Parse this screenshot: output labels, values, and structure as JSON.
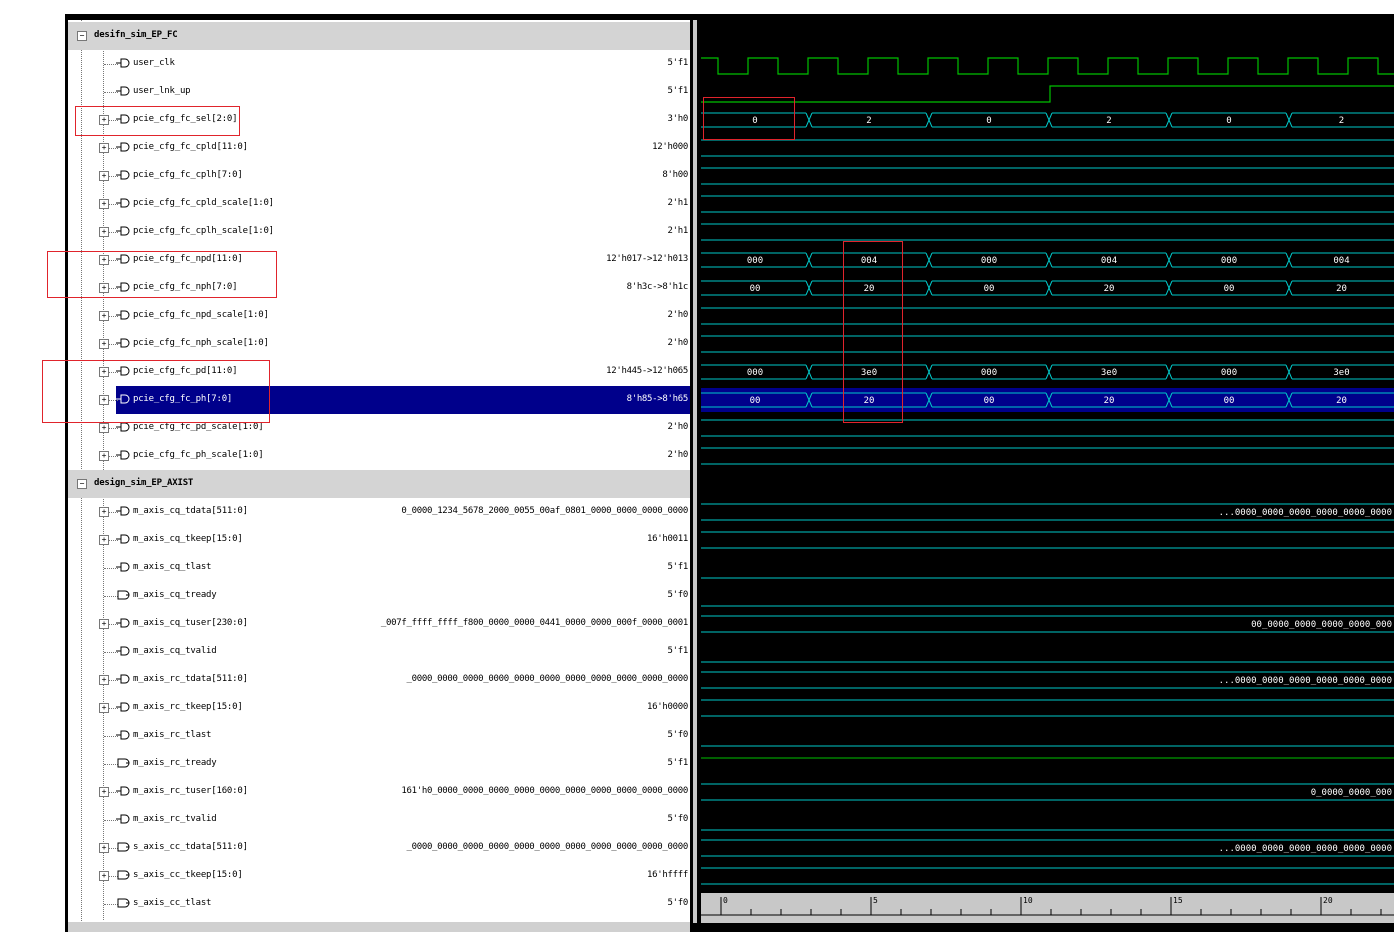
{
  "groups": [
    {
      "name": "desifn_sim_EP_FC"
    },
    {
      "name": "design_sim_EP_AXIST"
    }
  ],
  "signals": [
    {
      "name": "user_clk",
      "value": "5'f1",
      "expandable": false,
      "dir": "out"
    },
    {
      "name": "user_lnk_up",
      "value": "5'f1",
      "expandable": false,
      "dir": "out"
    },
    {
      "name": "pcie_cfg_fc_sel[2:0]",
      "value": "3'h0",
      "expandable": true,
      "dir": "out"
    },
    {
      "name": "pcie_cfg_fc_cpld[11:0]",
      "value": "12'h000",
      "expandable": true,
      "dir": "out"
    },
    {
      "name": "pcie_cfg_fc_cplh[7:0]",
      "value": "8'h00",
      "expandable": true,
      "dir": "out"
    },
    {
      "name": "pcie_cfg_fc_cpld_scale[1:0]",
      "value": "2'h1",
      "expandable": true,
      "dir": "out"
    },
    {
      "name": "pcie_cfg_fc_cplh_scale[1:0]",
      "value": "2'h1",
      "expandable": true,
      "dir": "out"
    },
    {
      "name": "pcie_cfg_fc_npd[11:0]",
      "value": "12'h017->12'h013",
      "expandable": true,
      "dir": "out"
    },
    {
      "name": "pcie_cfg_fc_nph[7:0]",
      "value": "8'h3c->8'h1c",
      "expandable": true,
      "dir": "out"
    },
    {
      "name": "pcie_cfg_fc_npd_scale[1:0]",
      "value": "2'h0",
      "expandable": true,
      "dir": "out"
    },
    {
      "name": "pcie_cfg_fc_nph_scale[1:0]",
      "value": "2'h0",
      "expandable": true,
      "dir": "out"
    },
    {
      "name": "pcie_cfg_fc_pd[11:0]",
      "value": "12'h445->12'h065",
      "expandable": true,
      "dir": "out"
    },
    {
      "name": "pcie_cfg_fc_ph[7:0]",
      "value": "8'h85->8'h65",
      "expandable": true,
      "dir": "out",
      "selected": true
    },
    {
      "name": "pcie_cfg_fc_pd_scale[1:0]",
      "value": "2'h0",
      "expandable": true,
      "dir": "out"
    },
    {
      "name": "pcie_cfg_fc_ph_scale[1:0]",
      "value": "2'h0",
      "expandable": true,
      "dir": "out"
    },
    {
      "name": "m_axis_cq_tdata[511:0]",
      "value": "0_0000_1234_5678_2000_0055_00af_0801_0000_0000_0000_0000",
      "expandable": true,
      "dir": "out"
    },
    {
      "name": "m_axis_cq_tkeep[15:0]",
      "value": "16'h0011",
      "expandable": true,
      "dir": "out"
    },
    {
      "name": "m_axis_cq_tlast",
      "value": "5'f1",
      "expandable": false,
      "dir": "out"
    },
    {
      "name": "m_axis_cq_tready",
      "value": "5'f0",
      "expandable": false,
      "dir": "in"
    },
    {
      "name": "m_axis_cq_tuser[230:0]",
      "value": "_007f_ffff_ffff_f800_0000_0000_0441_0000_0000_000f_0000_0001",
      "expandable": true,
      "dir": "out"
    },
    {
      "name": "m_axis_cq_tvalid",
      "value": "5'f1",
      "expandable": false,
      "dir": "out"
    },
    {
      "name": "m_axis_rc_tdata[511:0]",
      "value": "_0000_0000_0000_0000_0000_0000_0000_0000_0000_0000_0000",
      "expandable": true,
      "dir": "out"
    },
    {
      "name": "m_axis_rc_tkeep[15:0]",
      "value": "16'h0000",
      "expandable": true,
      "dir": "out"
    },
    {
      "name": "m_axis_rc_tlast",
      "value": "5'f0",
      "expandable": false,
      "dir": "out"
    },
    {
      "name": "m_axis_rc_tready",
      "value": "5'f1",
      "expandable": false,
      "dir": "in"
    },
    {
      "name": "m_axis_rc_tuser[160:0]",
      "value": "161'h0_0000_0000_0000_0000_0000_0000_0000_0000_0000_0000",
      "expandable": true,
      "dir": "out"
    },
    {
      "name": "m_axis_rc_tvalid",
      "value": "5'f0",
      "expandable": false,
      "dir": "out"
    },
    {
      "name": "s_axis_cc_tdata[511:0]",
      "value": "_0000_0000_0000_0000_0000_0000_0000_0000_0000_0000_0000",
      "expandable": true,
      "dir": "in"
    },
    {
      "name": "s_axis_cc_tkeep[15:0]",
      "value": "16'hffff",
      "expandable": true,
      "dir": "in"
    },
    {
      "name": "s_axis_cc_tlast",
      "value": "5'f0",
      "expandable": false,
      "dir": "in"
    }
  ],
  "waveform": {
    "bus_values": {
      "sel": [
        "0",
        "2",
        "0",
        "2",
        "0",
        "2"
      ],
      "npd": [
        "000",
        "004",
        "000",
        "004",
        "000",
        "004"
      ],
      "nph": [
        "00",
        "20",
        "00",
        "20",
        "00",
        "20"
      ],
      "pd": [
        "000",
        "3e0",
        "000",
        "3e0",
        "000",
        "3e0"
      ],
      "ph": [
        "00",
        "20",
        "00",
        "20",
        "00",
        "20"
      ]
    },
    "cq_tdata_label": "...0000_0000_0000_0000_0000_0000",
    "cq_tuser_label": "00_0000_0000_0000_0000_000",
    "rc_tdata_label": "...0000_0000_0000_0000_0000_0000",
    "rc_tuser_label": "0_0000_0000_000",
    "cc_tdata_label": "...0000_0000_0000_0000_0000_0000",
    "ruler_ticks": [
      "0",
      "5",
      "10",
      "15",
      "20"
    ]
  },
  "colors": {
    "clock": "#00c000",
    "bus": "#00c8c8",
    "selected_row": "#00008b",
    "group_row": "#d4d4d4",
    "highlight_box": "#e0242c"
  }
}
